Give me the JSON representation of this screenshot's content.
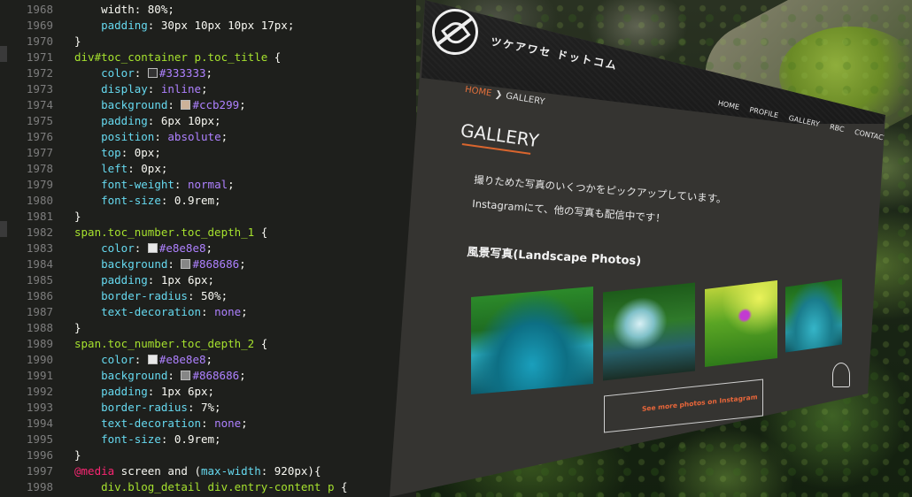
{
  "editor": {
    "lines": [
      {
        "n": "1968",
        "tokens": [
          {
            "t": "    width: 80%;",
            "c": "plain"
          }
        ]
      },
      {
        "n": "1969",
        "tokens": [
          {
            "t": "    ",
            "c": "plain"
          },
          {
            "t": "padding",
            "c": "prop"
          },
          {
            "t": ": 30px 10px 10px 17px;",
            "c": "plain"
          }
        ]
      },
      {
        "n": "1970",
        "tokens": [
          {
            "t": "}",
            "c": "plain"
          }
        ]
      },
      {
        "n": "1971",
        "tokens": [
          {
            "t": "div#toc_container p.toc_title",
            "c": "sel"
          },
          {
            "t": " {",
            "c": "plain"
          }
        ]
      },
      {
        "n": "1972",
        "tokens": [
          {
            "t": "    ",
            "c": "plain"
          },
          {
            "t": "color",
            "c": "prop"
          },
          {
            "t": ": ",
            "c": "plain"
          },
          {
            "sw": "#333333"
          },
          {
            "t": "#333333",
            "c": "val"
          },
          {
            "t": ";",
            "c": "plain"
          }
        ]
      },
      {
        "n": "1973",
        "tokens": [
          {
            "t": "    ",
            "c": "plain"
          },
          {
            "t": "display",
            "c": "prop"
          },
          {
            "t": ": ",
            "c": "plain"
          },
          {
            "t": "inline",
            "c": "val"
          },
          {
            "t": ";",
            "c": "plain"
          }
        ]
      },
      {
        "n": "1974",
        "tokens": [
          {
            "t": "    ",
            "c": "plain"
          },
          {
            "t": "background",
            "c": "prop"
          },
          {
            "t": ": ",
            "c": "plain"
          },
          {
            "sw": "#ccb299"
          },
          {
            "t": "#ccb299",
            "c": "val"
          },
          {
            "t": ";",
            "c": "plain"
          }
        ]
      },
      {
        "n": "1975",
        "tokens": [
          {
            "t": "    ",
            "c": "plain"
          },
          {
            "t": "padding",
            "c": "prop"
          },
          {
            "t": ": 6px 10px;",
            "c": "plain"
          }
        ]
      },
      {
        "n": "1976",
        "tokens": [
          {
            "t": "    ",
            "c": "plain"
          },
          {
            "t": "position",
            "c": "prop"
          },
          {
            "t": ": ",
            "c": "plain"
          },
          {
            "t": "absolute",
            "c": "val"
          },
          {
            "t": ";",
            "c": "plain"
          }
        ]
      },
      {
        "n": "1977",
        "tokens": [
          {
            "t": "    ",
            "c": "plain"
          },
          {
            "t": "top",
            "c": "prop"
          },
          {
            "t": ": 0px;",
            "c": "plain"
          }
        ]
      },
      {
        "n": "1978",
        "tokens": [
          {
            "t": "    ",
            "c": "plain"
          },
          {
            "t": "left",
            "c": "prop"
          },
          {
            "t": ": 0px;",
            "c": "plain"
          }
        ]
      },
      {
        "n": "1979",
        "tokens": [
          {
            "t": "    ",
            "c": "plain"
          },
          {
            "t": "font-weight",
            "c": "prop"
          },
          {
            "t": ": ",
            "c": "plain"
          },
          {
            "t": "normal",
            "c": "val"
          },
          {
            "t": ";",
            "c": "plain"
          }
        ]
      },
      {
        "n": "1980",
        "tokens": [
          {
            "t": "    ",
            "c": "plain"
          },
          {
            "t": "font-size",
            "c": "prop"
          },
          {
            "t": ": 0.9rem;",
            "c": "plain"
          }
        ]
      },
      {
        "n": "1981",
        "tokens": [
          {
            "t": "}",
            "c": "plain"
          }
        ]
      },
      {
        "n": "1982",
        "tokens": [
          {
            "t": "span.toc_number.toc_depth_1",
            "c": "sel"
          },
          {
            "t": " {",
            "c": "plain"
          }
        ]
      },
      {
        "n": "1983",
        "tokens": [
          {
            "t": "    ",
            "c": "plain"
          },
          {
            "t": "color",
            "c": "prop"
          },
          {
            "t": ": ",
            "c": "plain"
          },
          {
            "sw": "#e8e8e8"
          },
          {
            "t": "#e8e8e8",
            "c": "val"
          },
          {
            "t": ";",
            "c": "plain"
          }
        ]
      },
      {
        "n": "1984",
        "tokens": [
          {
            "t": "    ",
            "c": "plain"
          },
          {
            "t": "background",
            "c": "prop"
          },
          {
            "t": ": ",
            "c": "plain"
          },
          {
            "sw": "#868686"
          },
          {
            "t": "#868686",
            "c": "val"
          },
          {
            "t": ";",
            "c": "plain"
          }
        ]
      },
      {
        "n": "1985",
        "tokens": [
          {
            "t": "    ",
            "c": "plain"
          },
          {
            "t": "padding",
            "c": "prop"
          },
          {
            "t": ": 1px 6px;",
            "c": "plain"
          }
        ]
      },
      {
        "n": "1986",
        "tokens": [
          {
            "t": "    ",
            "c": "plain"
          },
          {
            "t": "border-radius",
            "c": "prop"
          },
          {
            "t": ": 50%;",
            "c": "plain"
          }
        ]
      },
      {
        "n": "1987",
        "tokens": [
          {
            "t": "    ",
            "c": "plain"
          },
          {
            "t": "text-decoration",
            "c": "prop"
          },
          {
            "t": ": ",
            "c": "plain"
          },
          {
            "t": "none",
            "c": "val"
          },
          {
            "t": ";",
            "c": "plain"
          }
        ]
      },
      {
        "n": "1988",
        "tokens": [
          {
            "t": "}",
            "c": "plain"
          }
        ]
      },
      {
        "n": "1989",
        "tokens": [
          {
            "t": "span.toc_number.toc_depth_2",
            "c": "sel"
          },
          {
            "t": " {",
            "c": "plain"
          }
        ]
      },
      {
        "n": "1990",
        "tokens": [
          {
            "t": "    ",
            "c": "plain"
          },
          {
            "t": "color",
            "c": "prop"
          },
          {
            "t": ": ",
            "c": "plain"
          },
          {
            "sw": "#e8e8e8"
          },
          {
            "t": "#e8e8e8",
            "c": "val"
          },
          {
            "t": ";",
            "c": "plain"
          }
        ]
      },
      {
        "n": "1991",
        "tokens": [
          {
            "t": "    ",
            "c": "plain"
          },
          {
            "t": "background",
            "c": "prop"
          },
          {
            "t": ": ",
            "c": "plain"
          },
          {
            "sw": "#868686"
          },
          {
            "t": "#868686",
            "c": "val"
          },
          {
            "t": ";",
            "c": "plain"
          }
        ]
      },
      {
        "n": "1992",
        "tokens": [
          {
            "t": "    ",
            "c": "plain"
          },
          {
            "t": "padding",
            "c": "prop"
          },
          {
            "t": ": 1px 6px;",
            "c": "plain"
          }
        ]
      },
      {
        "n": "1993",
        "tokens": [
          {
            "t": "    ",
            "c": "plain"
          },
          {
            "t": "border-radius",
            "c": "prop"
          },
          {
            "t": ": 7%;",
            "c": "plain"
          }
        ]
      },
      {
        "n": "1994",
        "tokens": [
          {
            "t": "    ",
            "c": "plain"
          },
          {
            "t": "text-decoration",
            "c": "prop"
          },
          {
            "t": ": ",
            "c": "plain"
          },
          {
            "t": "none",
            "c": "val"
          },
          {
            "t": ";",
            "c": "plain"
          }
        ]
      },
      {
        "n": "1995",
        "tokens": [
          {
            "t": "    ",
            "c": "plain"
          },
          {
            "t": "font-size",
            "c": "prop"
          },
          {
            "t": ": 0.9rem;",
            "c": "plain"
          }
        ]
      },
      {
        "n": "1996",
        "tokens": [
          {
            "t": "}",
            "c": "plain"
          }
        ]
      },
      {
        "n": "1997",
        "tokens": [
          {
            "t": "@media",
            "c": "kw"
          },
          {
            "t": " screen and (",
            "c": "plain"
          },
          {
            "t": "max-width",
            "c": "prop"
          },
          {
            "t": ": 920px){",
            "c": "plain"
          }
        ]
      },
      {
        "n": "1998",
        "tokens": [
          {
            "t": "    div.blog_detail div.entry-content p",
            "c": "sel"
          },
          {
            "t": " {",
            "c": "plain"
          }
        ]
      }
    ]
  },
  "site": {
    "title": "ツケアワセ ドットコム",
    "nav": [
      "HOME",
      "PROFILE",
      "GALLERY",
      "RBC",
      "CONTACT"
    ],
    "breadcrumb": {
      "home": "HOME",
      "separator": "❯",
      "current": "GALLERY"
    },
    "page_title": "GALLERY",
    "intro": [
      "撮りためた写真のいくつかをピックアップしています。",
      "Instagramにて、他の写真も配信中です！"
    ],
    "section_heading": "風景写真(Landscape Photos)",
    "instagram_button": "See more photos on Instagram",
    "colors": {
      "accent": "#e4703b",
      "body_bg": "#353431",
      "header_bg": "#1a1a1a"
    }
  }
}
